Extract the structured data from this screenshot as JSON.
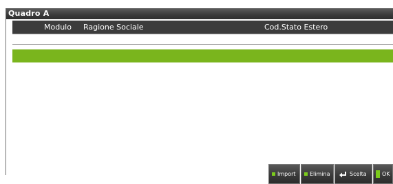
{
  "window": {
    "title": "Quadro A"
  },
  "grid": {
    "columns": [
      "Modulo",
      "Ragione Sociale",
      "Cod.Stato Estero"
    ]
  },
  "toolbar": {
    "import_label": "Import",
    "elimina_label": "Elimina",
    "scelta_label": "Scelta",
    "ok_label": "OK"
  },
  "colors": {
    "selection": "#7ab51d",
    "accent_square": "#7ccc1c",
    "header_bg": "#3c3c3c"
  },
  "icons": {
    "import": "green-square-icon",
    "elimina": "green-square-icon",
    "scelta": "enter-arrow-icon",
    "ok": "green-bar-icon"
  }
}
